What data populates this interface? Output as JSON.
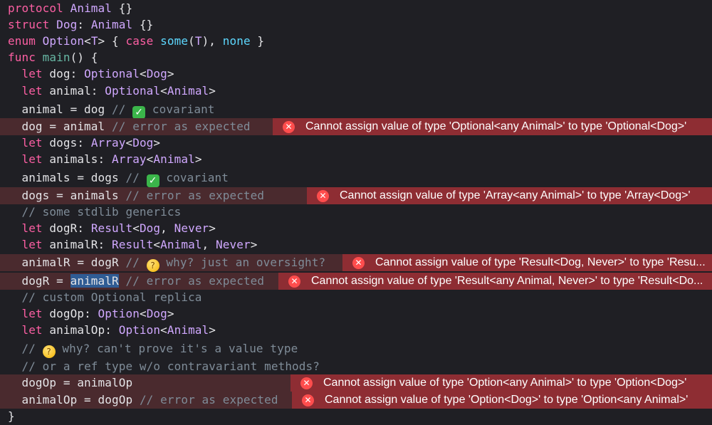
{
  "lines": [
    {
      "text": "protocol Animal {}"
    },
    {
      "text": "struct Dog: Animal {}"
    },
    {
      "text": "enum Option<T> { case some(T), none }"
    },
    {
      "text": "func main() {"
    },
    {
      "text": "  let dog: Optional<Dog>"
    },
    {
      "text": "  let animal: Optional<Animal>"
    },
    {
      "text": "  animal = dog // ✅ covariant"
    },
    {
      "text": "  dog = animal // error as expected"
    },
    {
      "text": "  let dogs: Array<Dog>"
    },
    {
      "text": "  let animals: Array<Animal>"
    },
    {
      "text": "  animals = dogs // ✅ covariant"
    },
    {
      "text": "  dogs = animals // error as expected"
    },
    {
      "text": "  // some stdlib generics"
    },
    {
      "text": "  let dogR: Result<Dog, Never>"
    },
    {
      "text": "  let animalR: Result<Animal, Never>"
    },
    {
      "text": "  animalR = dogR // 🤔 why? just an oversight?"
    },
    {
      "text": "  dogR = animalR // error as expected"
    },
    {
      "text": "  // custom Optional replica"
    },
    {
      "text": "  let dogOp: Option<Dog>"
    },
    {
      "text": "  let animalOp: Option<Animal>"
    },
    {
      "text": "  // 🤔 why? can't prove it's a value type"
    },
    {
      "text": "  // or a ref type w/o contravariant methods?"
    },
    {
      "text": "  dogOp = animalOp"
    },
    {
      "text": "  animalOp = dogOp // error as expected"
    },
    {
      "text": "}"
    }
  ],
  "errors": [
    {
      "line": 8,
      "message": "Cannot assign value of type 'Optional<any Animal>' to type 'Optional<Dog>'"
    },
    {
      "line": 12,
      "message": "Cannot assign value of type 'Array<any Animal>' to type 'Array<Dog>'"
    },
    {
      "line": 16,
      "message": "Cannot assign value of type 'Result<Dog, Never>' to type 'Resu..."
    },
    {
      "line": 17,
      "message": "Cannot assign value of type 'Result<any Animal, Never>' to type 'Result<Do..."
    },
    {
      "line": 23,
      "message": "Cannot assign value of type 'Option<any Animal>' to type 'Option<Dog>'"
    },
    {
      "line": 24,
      "message": "Cannot assign value of type 'Option<Dog>' to type 'Option<any Animal>'"
    }
  ],
  "icons": {
    "error": "error-x-circle-icon",
    "check": "white-check-mark-emoji-icon",
    "thinking": "thinking-face-emoji-icon"
  },
  "colors": {
    "background": "#1f1f24",
    "keyword": "#fc5fa3",
    "type": "#d0a8ff",
    "comment": "#7f8c98",
    "error_banner": "#8e2d33",
    "error_line": "#4a2a2e",
    "selection": "#2f5c94"
  }
}
